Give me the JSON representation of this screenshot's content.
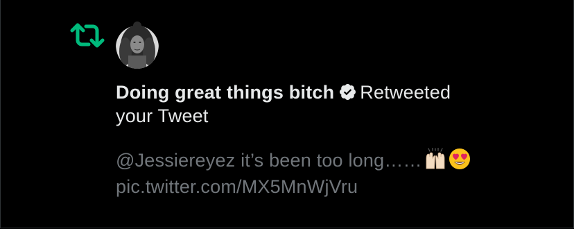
{
  "notification": {
    "type_icon": "retweet-icon",
    "avatar_icon": "user-avatar",
    "user_name": "Doing great things bitch",
    "verified_icon": "verified-badge-icon",
    "action_line1": "Retweeted",
    "action_line2": "your Tweet",
    "tweet_text": "@Jessiereyez it’s been too long……",
    "emojis": [
      "raising-hands-emoji",
      "heart-eyes-emoji"
    ],
    "tweet_link": "pic.twitter.com/MX5MnWjVru"
  },
  "colors": {
    "background": "#000000",
    "primary_text": "#e7e9ea",
    "secondary_text": "#71767b",
    "retweet_green": "#00ba7c",
    "border": "#2f3336"
  }
}
